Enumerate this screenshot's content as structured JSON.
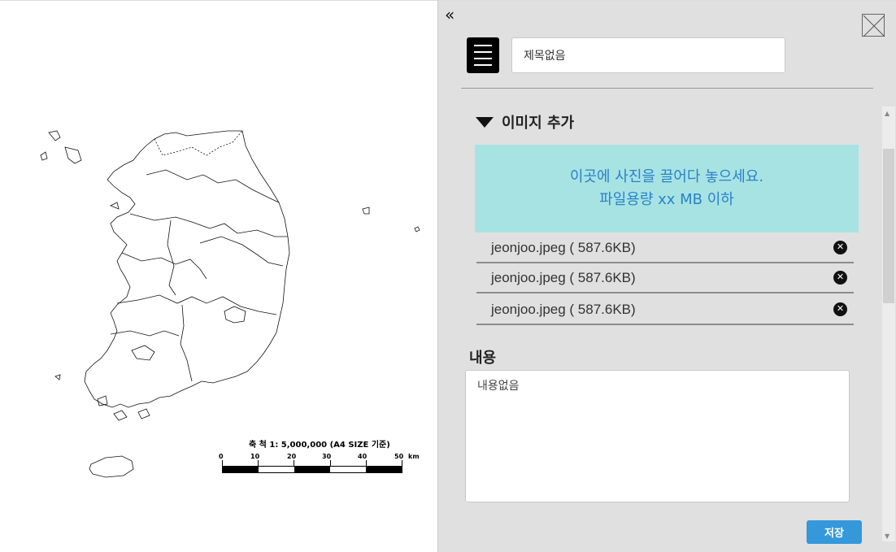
{
  "map": {
    "scale_title": "축 척 1: 5,000,000 (A4 SIZE 기준)",
    "scale_ticks": [
      "0",
      "10",
      "20",
      "30",
      "40",
      "50"
    ],
    "scale_unit": "km"
  },
  "panel": {
    "collapse_icon": "«",
    "close_icon": "close-box-icon",
    "title_input_value": "제목없음",
    "image_section": {
      "title": "이미지 추가",
      "drop_zone_line1": "이곳에 사진을 끌어다 놓으세요.",
      "drop_zone_line2": "파일용량 xx MB 이하",
      "files": [
        {
          "name": "jeonjoo.jpeg ( 587.6KB)"
        },
        {
          "name": "jeonjoo.jpeg ( 587.6KB)"
        },
        {
          "name": "jeonjoo.jpeg ( 587.6KB)"
        }
      ]
    },
    "content_label": "내용",
    "content_value": "내용없음",
    "save_label": "저장"
  },
  "colors": {
    "panel_bg": "#e0e0e0",
    "drop_zone_bg": "#a8e3e3",
    "drop_zone_text": "#2a82c9",
    "save_button": "#3498db"
  }
}
